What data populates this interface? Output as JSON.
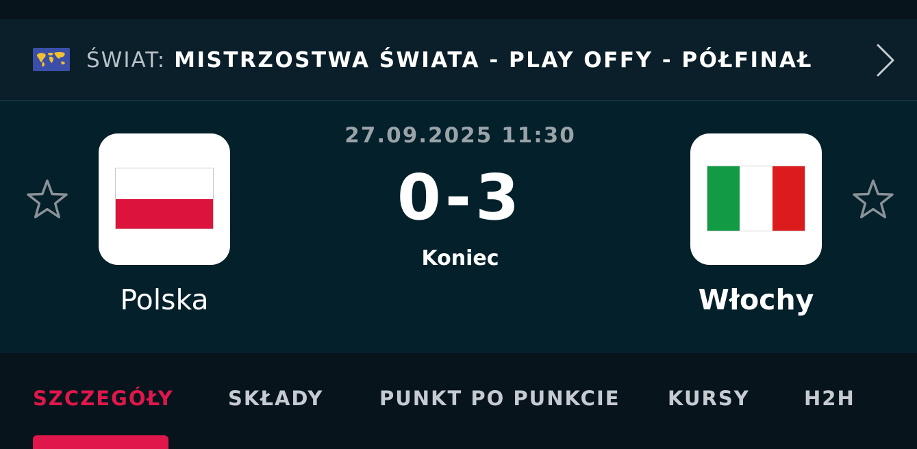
{
  "league": {
    "country": "ŚWIAT:",
    "name": "MISTRZOSTWA ŚWIATA - PLAY OFFY - PÓŁFINAŁ",
    "icon": "world-map-flag-icon"
  },
  "match": {
    "datetime": "27.09.2025 11:30",
    "score": "0-3",
    "status": "Koniec",
    "home": {
      "name": "Polska",
      "flag_colors": [
        "#ffffff",
        "#dc143c"
      ]
    },
    "away": {
      "name": "Włochy",
      "flag_colors": [
        "#129b44",
        "#ffffff",
        "#dc1c1c"
      ]
    }
  },
  "tabs": [
    {
      "label": "SZCZEGÓŁY",
      "active": true
    },
    {
      "label": "SKŁADY",
      "active": false
    },
    {
      "label": "PUNKT PO PUNKCIE",
      "active": false
    },
    {
      "label": "KURSY",
      "active": false
    },
    {
      "label": "H2H",
      "active": false
    }
  ],
  "colors": {
    "accent": "#e0174b",
    "background": "#04202b",
    "tab_bar": "#07141c"
  }
}
